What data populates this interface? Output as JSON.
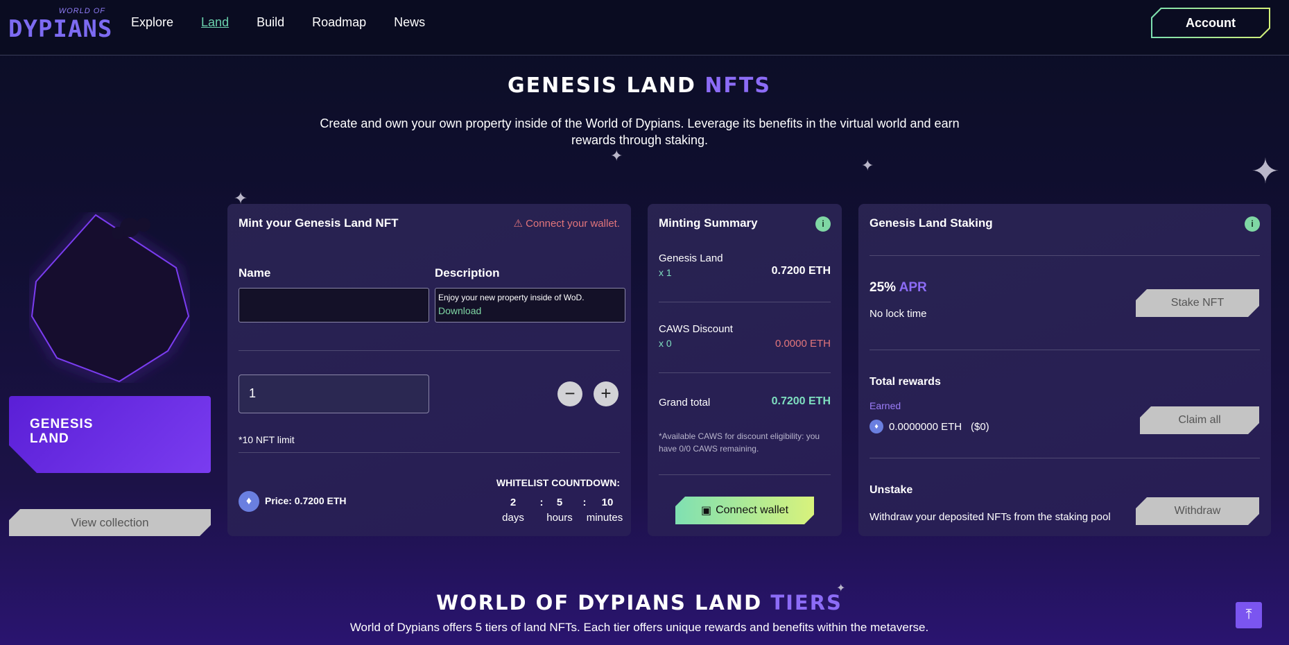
{
  "header": {
    "logo_small": "WORLD OF",
    "logo_main": "DYPIANS",
    "nav": [
      {
        "label": "Explore"
      },
      {
        "label": "Land"
      },
      {
        "label": "Build"
      },
      {
        "label": "Roadmap"
      },
      {
        "label": "News"
      }
    ],
    "active_nav": "Land",
    "account_label": "Account"
  },
  "hero": {
    "title_main": "GENESIS LAND ",
    "title_accent": "NFTS",
    "subtitle": "Create and own your own property inside of the World of Dypians. Leverage its benefits in the virtual world and earn rewards through staking."
  },
  "collection": {
    "tile_label": "GENESIS LAND",
    "view_collection": "View collection"
  },
  "mint": {
    "title": "Mint your Genesis Land NFT",
    "warning": "Connect your wallet.",
    "name_label": "Name",
    "name_value": "",
    "description_label": "Description",
    "description_text": "Enjoy your new property inside of WoD.",
    "description_link": "Download",
    "quantity": "1",
    "limit_note": "*10 NFT limit",
    "price": "Price: 0.7200 ETH",
    "countdown_title": "WHITELIST COUNTDOWN:",
    "countdown": {
      "days": "2",
      "hours": "5",
      "minutes": "10",
      "sep": ":"
    },
    "countdown_units": {
      "days": "days",
      "hours": "hours",
      "minutes": "minutes"
    }
  },
  "summary": {
    "title": "Minting Summary",
    "info": "i",
    "rows": [
      {
        "label": "Genesis Land",
        "sub": "x 1",
        "value": "0.7200 ETH"
      },
      {
        "label": "CAWS Discount",
        "sub": "x 0",
        "value": "0.0000 ETH"
      }
    ],
    "grand_total_label": "Grand total",
    "grand_total_value": "0.7200 ETH",
    "note": "*Available CAWS for discount eligibility: you have 0/0 CAWS remaining.",
    "connect_label": "Connect wallet"
  },
  "staking": {
    "title": "Genesis Land Staking",
    "info": "i",
    "apr_value": "25% ",
    "apr_label": "APR",
    "lock": "No lock time",
    "stake_btn": "Stake NFT",
    "rewards_title": "Total rewards",
    "earned_label": "Earned",
    "earned_value": "0.0000000 ETH",
    "earned_usd": "($0)",
    "claim_btn": "Claim all",
    "unstake_title": "Unstake",
    "unstake_desc": "Withdraw your deposited NFTs from the staking pool",
    "withdraw_btn": "Withdraw"
  },
  "tiers": {
    "title_main": "WORLD OF DYPIANS LAND ",
    "title_accent": "TIERS",
    "subtitle": "World of Dypians offers 5 tiers of land NFTs. Each tier offers unique rewards and benefits within the metaverse."
  },
  "colors": {
    "accent_purple": "#8c6cf6",
    "accent_green": "#7fd7a4",
    "warning_red": "#e2757b"
  }
}
